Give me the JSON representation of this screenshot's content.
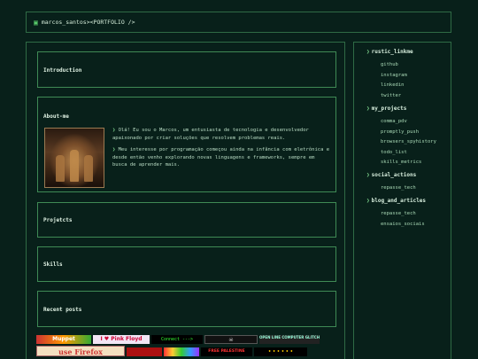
{
  "header": {
    "logo_icon": "terminal-icon",
    "title": "marcos_santos><PORTFOLIO />"
  },
  "sections": {
    "intro": "Introduction",
    "about": "About-me",
    "projects": "Projetcts",
    "skills": "Skills",
    "posts": "Recent posts"
  },
  "about": {
    "para1": "Olá! Eu sou o Marcos, um entusiasta de tecnologia e desenvolvedor apaixonado por criar soluções que resolvem problemas reais.",
    "para2": "Meu interesse por programação começou ainda na infância com eletrônica e desde então venho explorando novas linguagens e frameworks, sempre em busca de aprender mais."
  },
  "sidebar": {
    "groups": [
      {
        "label": "rustic_linkme",
        "items": [
          "github",
          "instagram",
          "linkedin",
          "twitter"
        ]
      },
      {
        "label": "my_projects",
        "items": [
          "comma_pdv",
          "promptly_push",
          "browsers_spyhistory",
          "todo_list",
          "skills_metrics"
        ]
      },
      {
        "label": "social_actions",
        "items": [
          "repasse_tech"
        ]
      },
      {
        "label": "blog_and_articles",
        "items": [
          "repasse_tech",
          "ensaios_sociais"
        ]
      }
    ]
  },
  "badges": {
    "b1": "Muppet",
    "b2": "I ♥ Pink Floyd",
    "b3": "Connect --->",
    "b5": "OPEN LINE COMPUTER GLITCH",
    "b6": "use Firefox",
    "b9": "FREE PALESTINE",
    "b10": "• • • • • •"
  },
  "colors": {
    "background": "#08201a",
    "border": "#2f6b45",
    "accent": "#7ed38d"
  }
}
